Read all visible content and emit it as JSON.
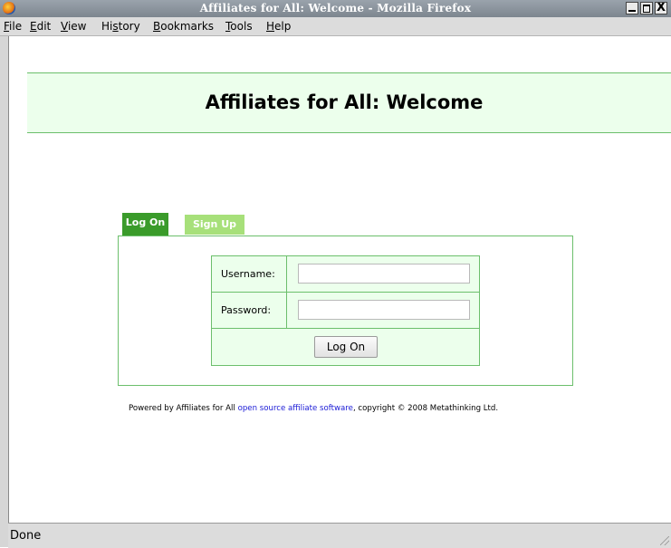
{
  "window": {
    "title": "Affiliates for All: Welcome - Mozilla Firefox",
    "close_glyph": "X"
  },
  "menu": [
    {
      "pre": "",
      "ul": "F",
      "post": "ile"
    },
    {
      "pre": "",
      "ul": "E",
      "post": "dit"
    },
    {
      "pre": "",
      "ul": "V",
      "post": "iew"
    },
    {
      "pre": "Hi",
      "ul": "s",
      "post": "tory"
    },
    {
      "pre": "",
      "ul": "B",
      "post": "ookmarks"
    },
    {
      "pre": "",
      "ul": "T",
      "post": "ools"
    },
    {
      "pre": "",
      "ul": "H",
      "post": "elp"
    }
  ],
  "page": {
    "heading": "Affiliates for All: Welcome",
    "tabs": {
      "logon": "Log On",
      "signup": "Sign Up"
    },
    "form": {
      "username_label": "Username:",
      "username_value": "",
      "password_label": "Password:",
      "password_value": "",
      "submit_label": "Log On"
    },
    "footer": {
      "prefix": "Powered by Affiliates for All ",
      "link": "open source affiliate software",
      "suffix": ", copyright © 2008 Metathinking Ltd."
    }
  },
  "statusbar": {
    "text": "Done"
  },
  "colors": {
    "accent_green": "#3a9b2a",
    "light_green": "#a7e07a",
    "panel_bg": "#ecffec",
    "border_green": "#6cbf6c",
    "link": "#1a1ad6"
  }
}
